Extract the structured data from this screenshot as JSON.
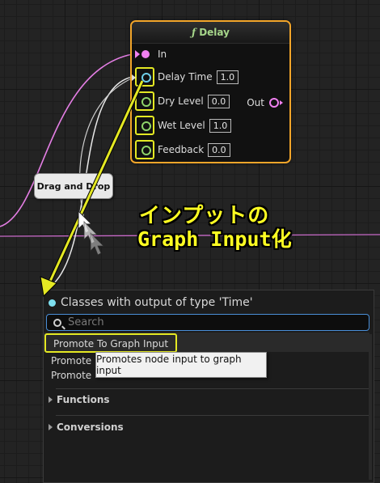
{
  "node": {
    "title": "Delay",
    "title_icon": "function-icon",
    "inputs": [
      {
        "label": "In",
        "type": "exec"
      },
      {
        "label": "Delay Time",
        "value": "1.0"
      },
      {
        "label": "Dry Level",
        "value": "0.0"
      },
      {
        "label": "Wet Level",
        "value": "1.0"
      },
      {
        "label": "Feedback",
        "value": "0.0"
      }
    ],
    "output": {
      "label": "Out"
    }
  },
  "drag_tip": "Drag and Drop",
  "annotation": {
    "line1": "インプットの",
    "line2": "Graph Input化"
  },
  "menu": {
    "title": "Classes with output of type 'Time'",
    "search_placeholder": "Search",
    "items": [
      "Promote To Graph Input",
      "Promote",
      "Promote"
    ],
    "sections": [
      "Functions",
      "Conversions"
    ]
  },
  "tooltip": "Promotes node input to graph input",
  "colors": {
    "highlight": "#e4e823",
    "node_border": "#f2a52a",
    "exec_wire": "#f080f0",
    "float_pin": "#8fd46a",
    "time_pin": "#6fd0ea",
    "search_border": "#4a8fd8"
  }
}
